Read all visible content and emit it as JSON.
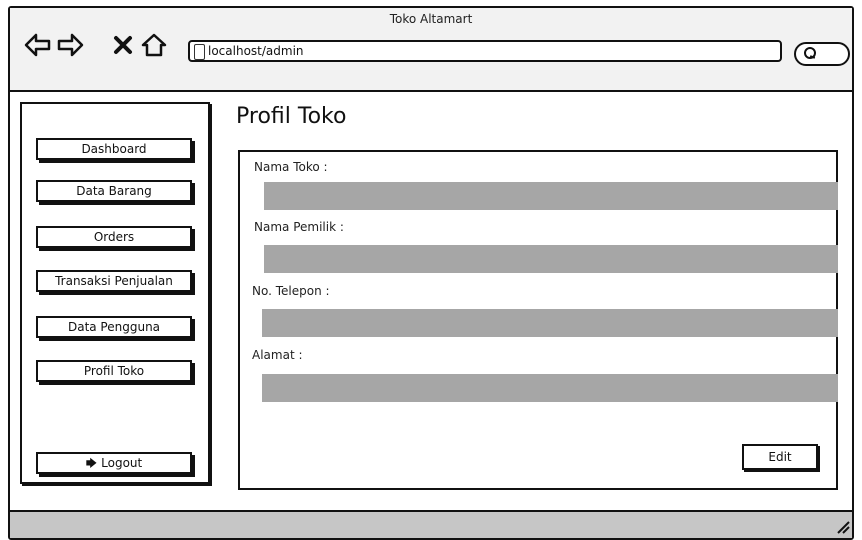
{
  "window": {
    "title": "Toko Altamart"
  },
  "toolbar": {
    "url": "localhost/admin",
    "icons": [
      "back-arrow-icon",
      "forward-arrow-icon",
      "close-icon",
      "home-icon",
      "search-icon"
    ]
  },
  "sidebar": {
    "items": [
      {
        "label": "Dashboard"
      },
      {
        "label": "Data Barang"
      },
      {
        "label": "Orders"
      },
      {
        "label": "Transaksi Penjualan"
      },
      {
        "label": "Data Pengguna"
      },
      {
        "label": "Profil Toko"
      }
    ],
    "logout_label": "Logout",
    "logout_icon": "logout-icon"
  },
  "main": {
    "title": "Profil Toko",
    "fields": [
      {
        "label": "Nama Toko :",
        "value": ""
      },
      {
        "label": "Nama Pemilik :",
        "value": ""
      },
      {
        "label": "No. Telepon :",
        "value": ""
      },
      {
        "label": "Alamat :",
        "value": ""
      }
    ],
    "edit_label": "Edit"
  },
  "colors": {
    "input_fill": "#a6a6a6",
    "statusbar": "#c6c6c6",
    "titlebar": "#f2f2f2",
    "stroke": "#111111"
  }
}
